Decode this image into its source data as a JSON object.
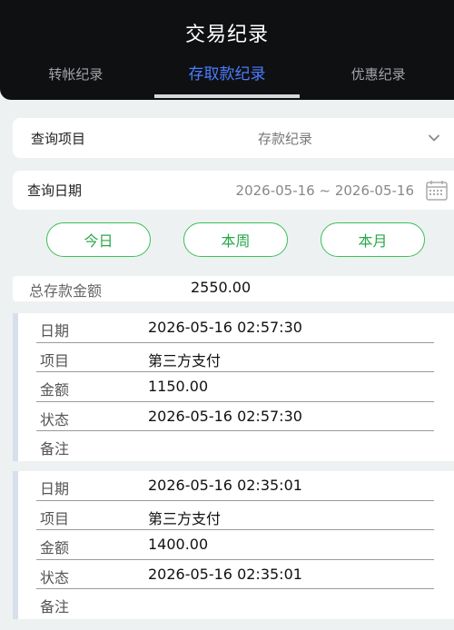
{
  "header": {
    "title": "交易纪录",
    "tabs": [
      {
        "label": "转帐纪录"
      },
      {
        "label": "存取款纪录"
      },
      {
        "label": "优惠纪录"
      }
    ],
    "active_tab": 1
  },
  "query": {
    "item_label": "查询项目",
    "item_value": "存款纪录",
    "date_label": "查询日期",
    "date_value": "2026-05-16 ~ 2026-05-16"
  },
  "quick_buttons": [
    {
      "label": "今日"
    },
    {
      "label": "本周"
    },
    {
      "label": "本月"
    }
  ],
  "summary": {
    "label": "总存款金额",
    "value": "2550.00"
  },
  "records": [
    {
      "rows": [
        {
          "key": "日期",
          "value": "2026-05-16 02:57:30"
        },
        {
          "key": "项目",
          "value": "第三方支付"
        },
        {
          "key": "金额",
          "value": "1150.00"
        },
        {
          "key": "状态",
          "value": "2026-05-16 02:57:30"
        },
        {
          "key": "备注",
          "value": ""
        }
      ]
    },
    {
      "rows": [
        {
          "key": "日期",
          "value": "2026-05-16 02:35:01"
        },
        {
          "key": "项目",
          "value": "第三方支付"
        },
        {
          "key": "金额",
          "value": "1400.00"
        },
        {
          "key": "状态",
          "value": "2026-05-16 02:35:01"
        },
        {
          "key": "备注",
          "value": ""
        }
      ]
    }
  ],
  "colors": {
    "header_bg": "#0f1012",
    "active_tab": "#4c7cff",
    "button_green": "#2aa84a",
    "page_bg": "#eef1f2"
  },
  "icons": [
    "chevron-down-icon",
    "calendar-icon"
  ]
}
